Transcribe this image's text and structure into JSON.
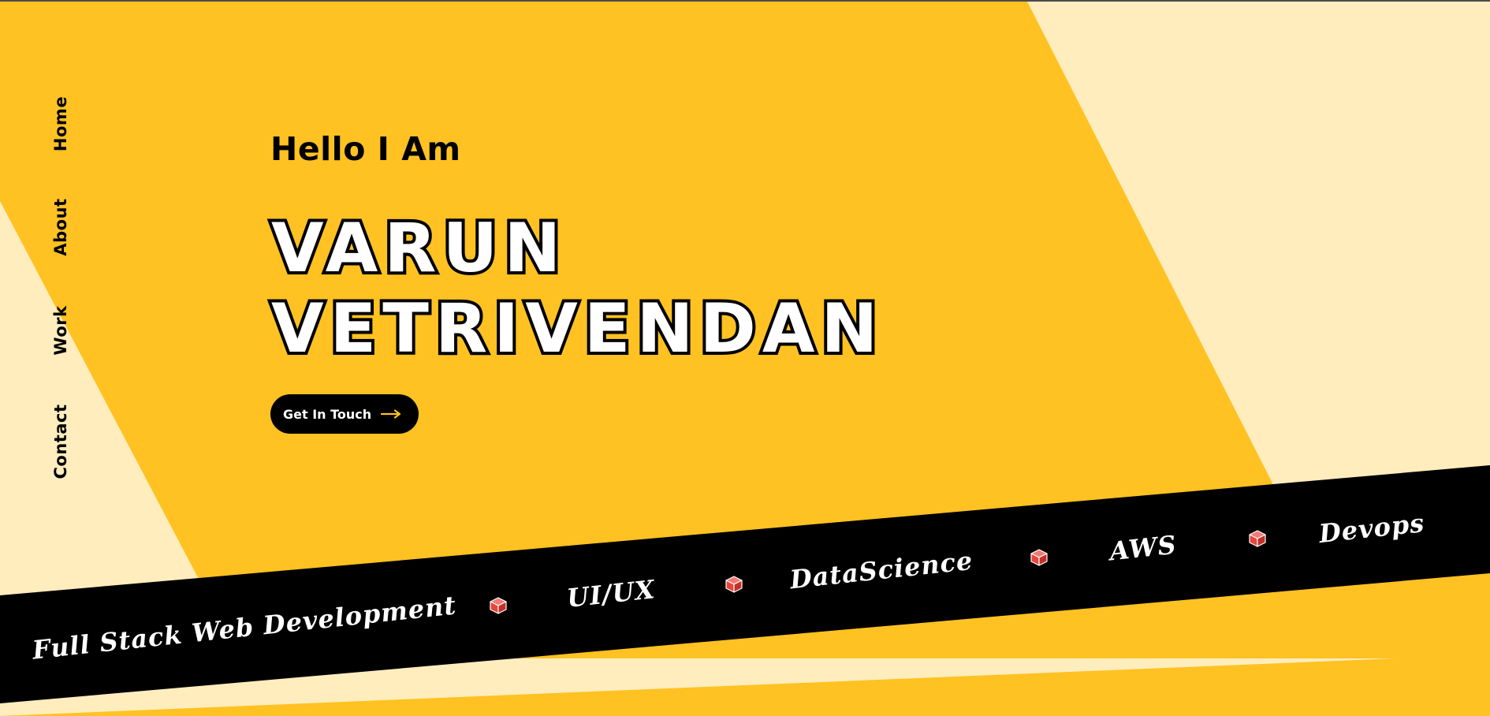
{
  "colors": {
    "yellow": "#FFC222",
    "cream": "#FFEDBD",
    "black": "#000000",
    "white": "#FFFFFF",
    "cube_red": "#E8453C",
    "arrow_yellow": "#FFC222"
  },
  "nav": {
    "items": [
      {
        "label": "Home"
      },
      {
        "label": "About"
      },
      {
        "label": "Work"
      },
      {
        "label": "Contact"
      }
    ]
  },
  "hero": {
    "greeting": "Hello I Am",
    "name_line1": "VARUN",
    "name_line2": "VETRIVENDAN",
    "cta_label": "Get In Touch",
    "cta_icon": "arrow-right-icon"
  },
  "skills": {
    "items": [
      {
        "label": "Full Stack Web Development"
      },
      {
        "label": "UI/UX"
      },
      {
        "label": "DataScience"
      },
      {
        "label": "AWS"
      },
      {
        "label": "Devops"
      }
    ],
    "separator_icon": "cube-icon"
  }
}
